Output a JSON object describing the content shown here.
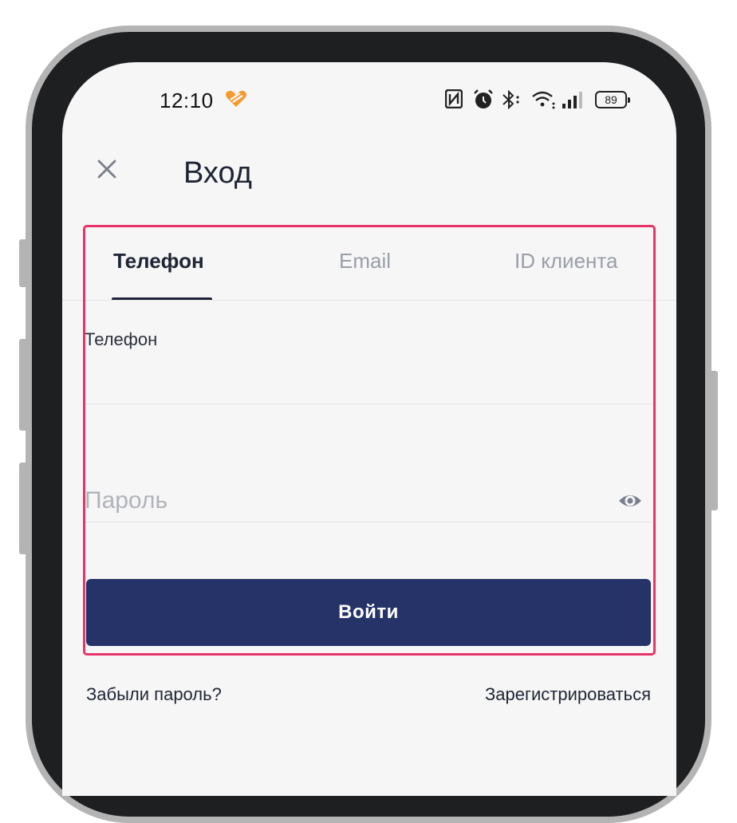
{
  "status_bar": {
    "time": "12:10",
    "battery_level": "89",
    "icons": [
      "nfc-icon",
      "alarm-icon",
      "bluetooth-icon",
      "wifi-icon",
      "signal-icon",
      "battery-icon"
    ]
  },
  "header": {
    "title": "Вход",
    "close_icon": "close-icon"
  },
  "tabs": [
    {
      "label": "Телефон",
      "active": true
    },
    {
      "label": "Email",
      "active": false
    },
    {
      "label": "ID клиента",
      "active": false
    }
  ],
  "form": {
    "phone_label": "Телефон",
    "phone_value": "",
    "password_placeholder": "Пароль",
    "password_value": "",
    "submit_label": "Войти"
  },
  "links": {
    "forgot_password": "Забыли пароль?",
    "register": "Зарегистрироваться"
  },
  "colors": {
    "primary": "#253368",
    "highlight": "#e8336a",
    "text_dark": "#1f2535",
    "text_muted": "#9a9ea8",
    "background": "#f6f6f6",
    "badge": "#f29a2e"
  }
}
